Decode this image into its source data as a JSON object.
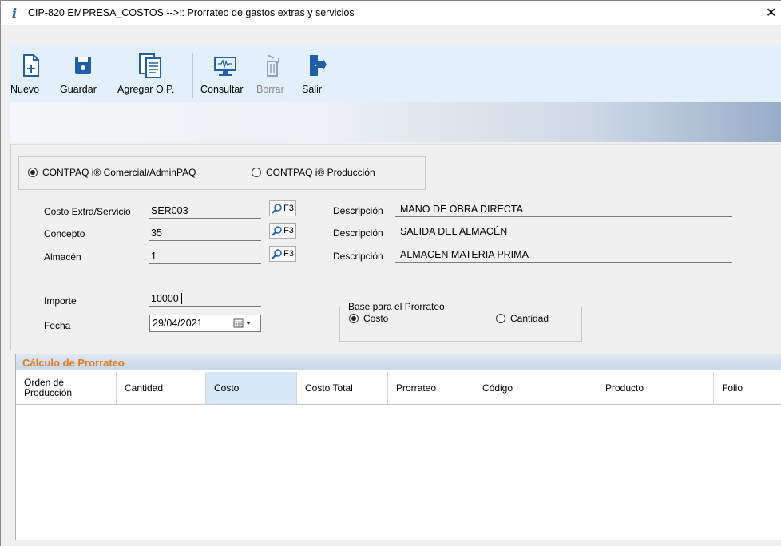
{
  "window": {
    "title": "CIP-820 EMPRESA_COSTOS -->:: Prorrateo de gastos extras y servicios",
    "close": "✕"
  },
  "toolbar": {
    "items": [
      {
        "label": "Nuevo",
        "icon": "new-document-icon",
        "enabled": true
      },
      {
        "label": "Guardar",
        "icon": "save-disk-icon",
        "enabled": true
      },
      {
        "label": "Agregar O.P.",
        "icon": "add-orders-icon",
        "enabled": true
      },
      {
        "label": "Consultar",
        "icon": "monitor-query-icon",
        "enabled": true
      },
      {
        "label": "Borrar",
        "icon": "delete-bin-icon",
        "enabled": false
      },
      {
        "label": "Salir",
        "icon": "exit-door-icon",
        "enabled": true
      }
    ]
  },
  "source": {
    "option1": "CONTPAQ i® Comercial/AdminPAQ",
    "option2": "CONTPAQ i® Producción",
    "selected": 1
  },
  "form": {
    "costo_label": "Costo Extra/Servicio",
    "costo_value": "SER003",
    "concepto_label": "Concepto",
    "concepto_value": "35",
    "almacen_label": "Almacén",
    "almacen_value": "1",
    "f3": "F3",
    "desc_label": "Descripción",
    "desc1": "MANO DE OBRA DIRECTA",
    "desc2": "SALIDA DEL ALMACÉN",
    "desc3": "ALMACEN MATERIA PRIMA",
    "importe_label": "Importe",
    "importe_value": "10000",
    "fecha_label": "Fecha",
    "fecha_value": "29/04/2021"
  },
  "base": {
    "title": "Base para el Prorrateo",
    "option1": "Costo",
    "option2": "Cantidad",
    "selected": 1
  },
  "grid": {
    "title": "Cálculo de Prorrateo",
    "columns": [
      "Orden de Producción",
      "Cantidad",
      "Costo",
      "Costo Total",
      "Prorrateo",
      "Código",
      "Producto",
      "Folio"
    ],
    "selected_column": "Costo",
    "rows": []
  },
  "colors": {
    "toolbar_bg": "#e3effa",
    "grid_title": "#e07b1a",
    "selected_col": "#d9e8f7",
    "icon_blue": "#1f5fa8"
  }
}
